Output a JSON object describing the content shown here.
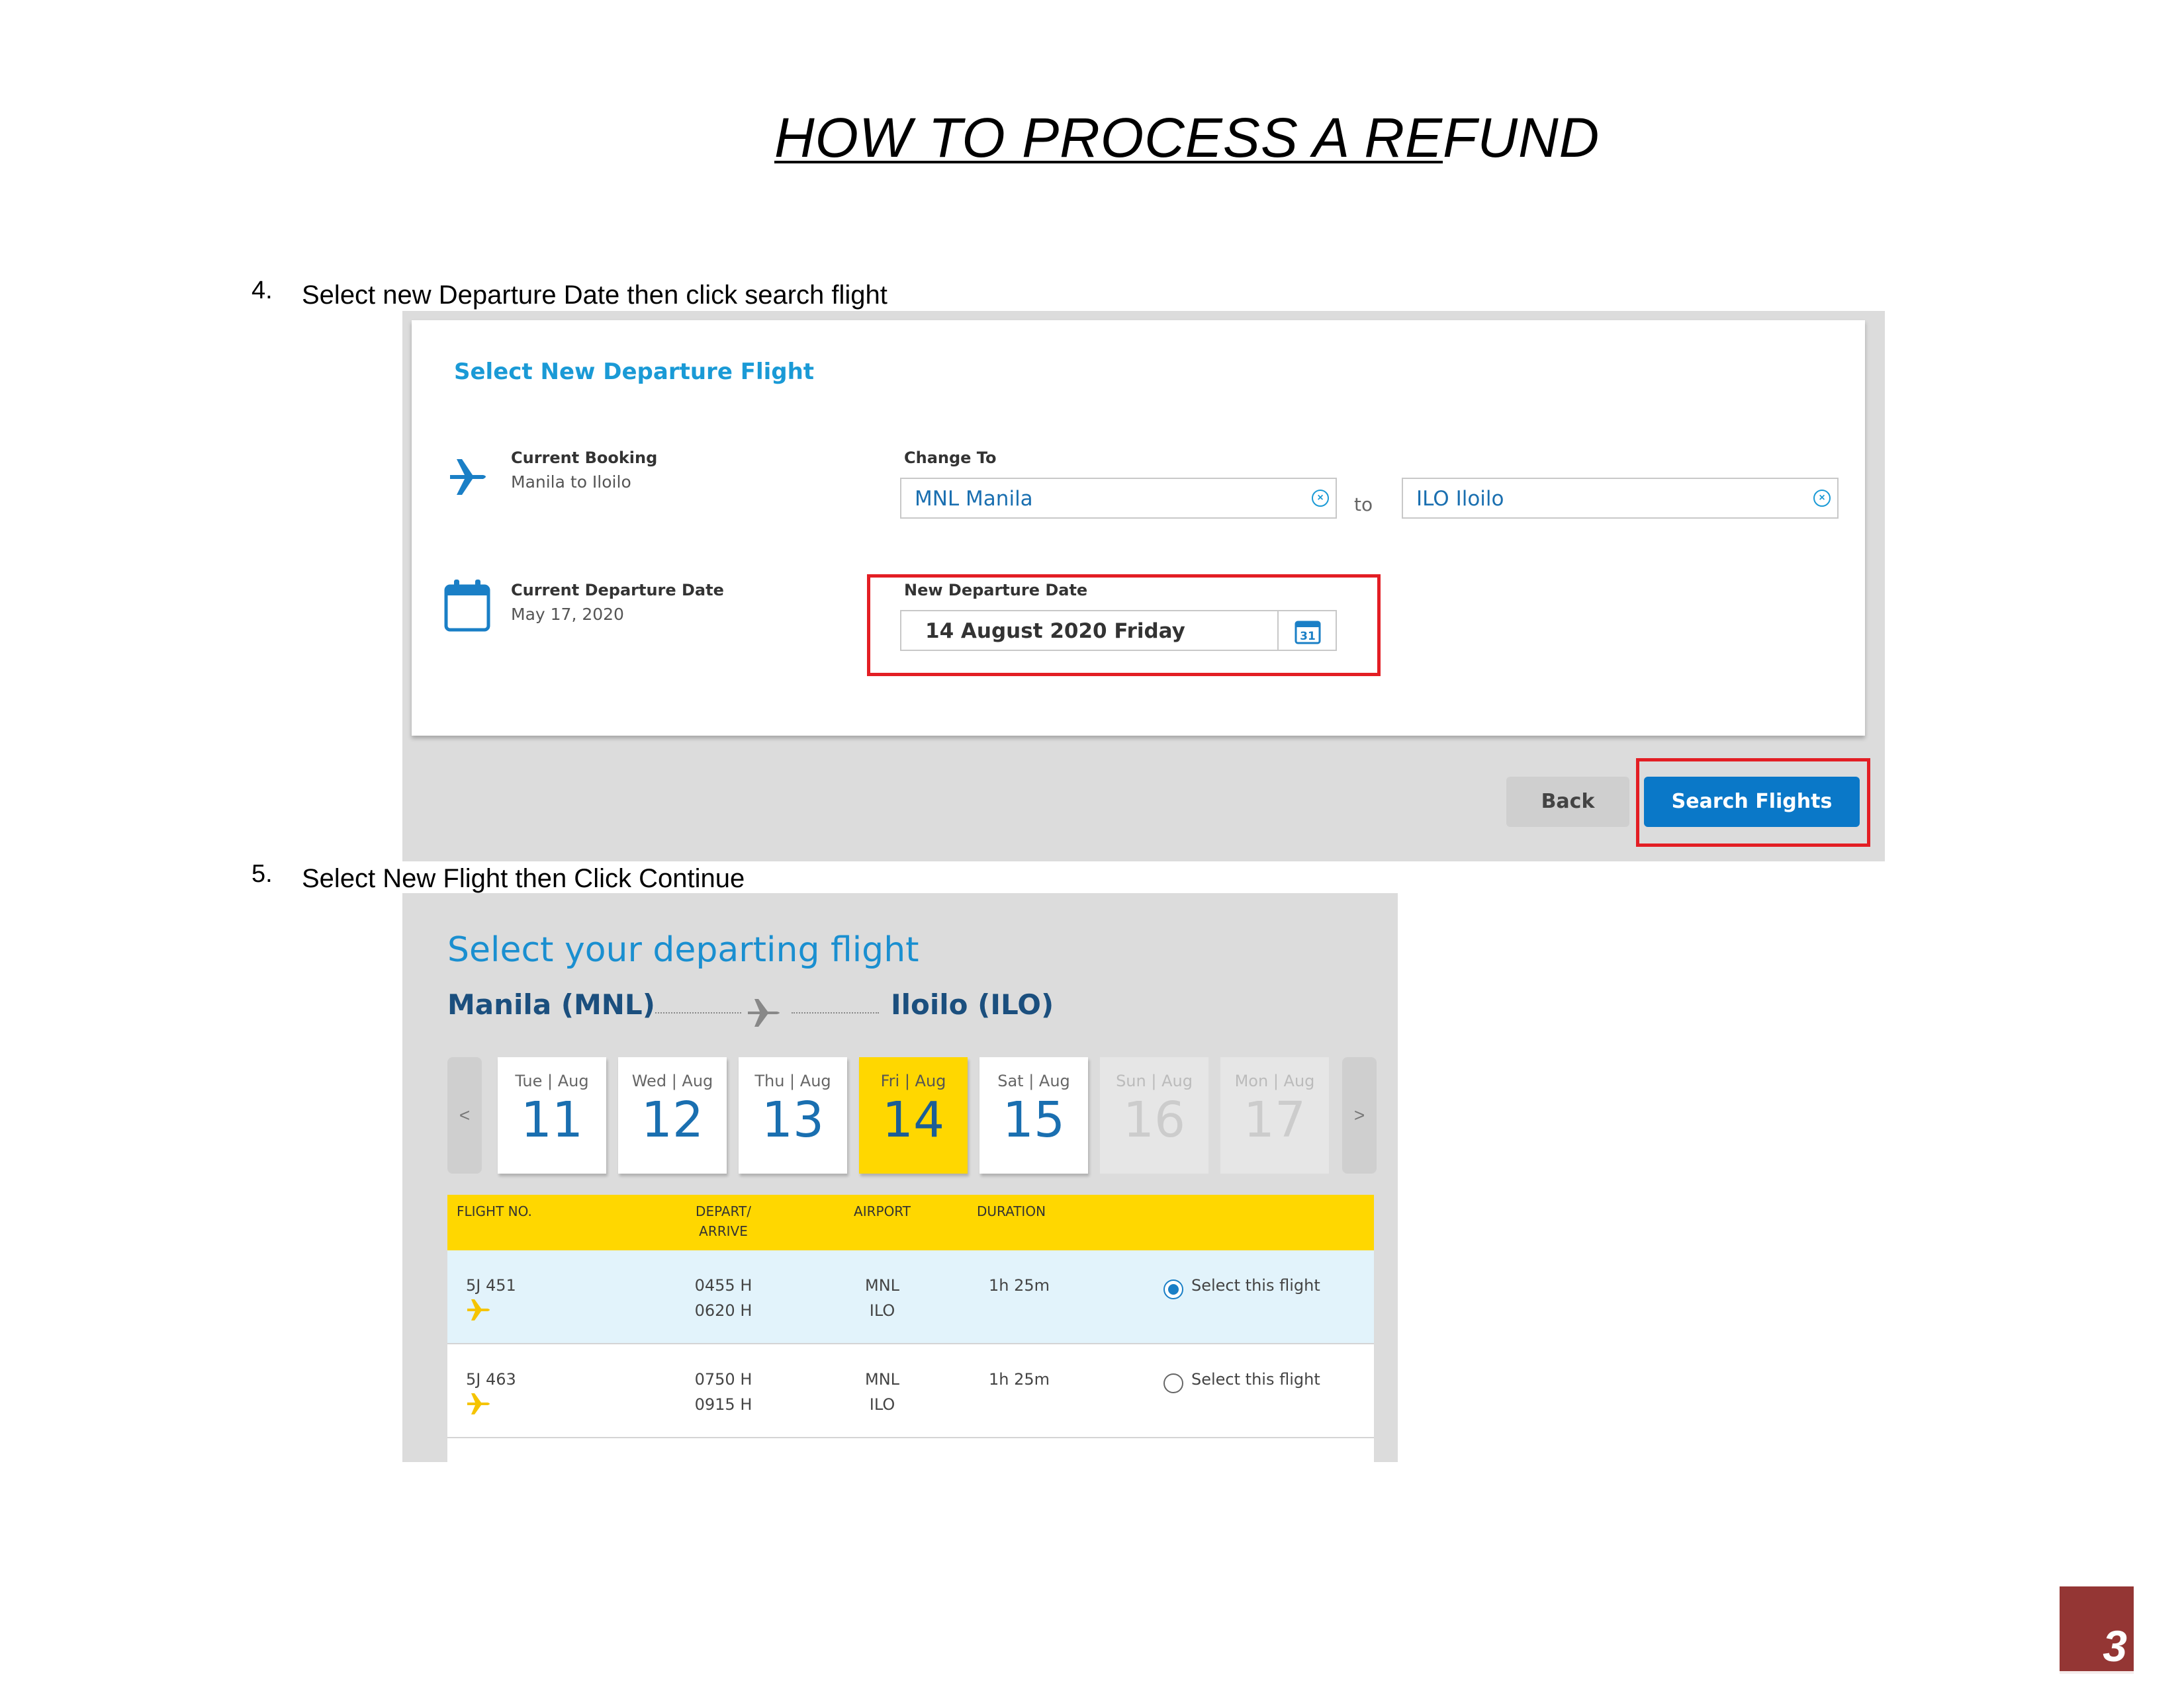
{
  "title": {
    "part1": "HOW TO PROCESS A RE",
    "part2": "FUND"
  },
  "steps": [
    {
      "number": "4.",
      "text": "Select new Departure Date then click search flight"
    },
    {
      "number": "5.",
      "text": "Select New Flight then Click Continue"
    }
  ],
  "change_flight": {
    "heading": "Select New Departure Flight",
    "current_booking_label": "Current Booking",
    "current_booking_value": "Manila to Iloilo",
    "change_to_label": "Change To",
    "origin_value": "MNL Manila",
    "to_text": "to",
    "destination_value": "ILO Iloilo",
    "current_date_label": "Current Departure Date",
    "current_date_value": "May 17, 2020",
    "new_date_label": "New Departure Date",
    "new_date_value": "14 August 2020 Friday",
    "calendar_icon_day": "31",
    "back_label": "Back",
    "search_label": "Search Flights"
  },
  "select_flight": {
    "heading": "Select your departing flight",
    "origin": "Manila (MNL)",
    "destination": "Iloilo (ILO)",
    "prev_arrow": "<",
    "next_arrow": ">",
    "dates": [
      {
        "dow": "Tue | Aug",
        "day": "11",
        "state": "normal"
      },
      {
        "dow": "Wed | Aug",
        "day": "12",
        "state": "normal"
      },
      {
        "dow": "Thu | Aug",
        "day": "13",
        "state": "normal"
      },
      {
        "dow": "Fri | Aug",
        "day": "14",
        "state": "selected"
      },
      {
        "dow": "Sat | Aug",
        "day": "15",
        "state": "normal"
      },
      {
        "dow": "Sun | Aug",
        "day": "16",
        "state": "disabled"
      },
      {
        "dow": "Mon | Aug",
        "day": "17",
        "state": "disabled"
      }
    ],
    "columns": {
      "flight_no": "FLIGHT NO.",
      "depart_arrive_1": "DEPART/",
      "depart_arrive_2": "ARRIVE",
      "airport": "AIRPORT",
      "duration": "DURATION"
    },
    "flights": [
      {
        "flight_no": "5J 451",
        "depart": "0455 H",
        "arrive": "0620 H",
        "from": "MNL",
        "to": "ILO",
        "duration": "1h 25m",
        "select_label": "Select this flight",
        "selected": true
      },
      {
        "flight_no": "5J 463",
        "depart": "0750 H",
        "arrive": "0915 H",
        "from": "MNL",
        "to": "ILO",
        "duration": "1h 25m",
        "select_label": "Select this flight",
        "selected": false
      }
    ]
  },
  "page_number": "3",
  "colors": {
    "accent_blue": "#1a9ad6",
    "button_blue": "#0a78c8",
    "highlight_red": "#e31e24",
    "selected_yellow": "#ffd700",
    "page_badge": "#943634"
  }
}
